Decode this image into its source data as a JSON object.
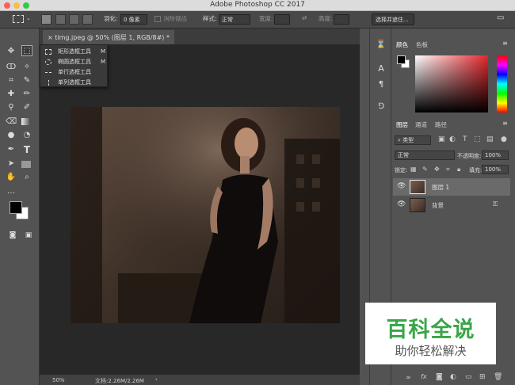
{
  "app": {
    "title": "Adobe Photoshop CC 2017"
  },
  "options_bar": {
    "feather_label": "羽化:",
    "feather_value": "0 像素",
    "antialias_label": "消除锯齿",
    "style_label": "样式:",
    "style_value": "正常",
    "width_label": "宽度:",
    "height_label": "高度:",
    "select_mask_button": "选择并遮住..."
  },
  "document": {
    "tab_label": "timg.jpeg @ 50% (图层 1, RGB/8#) *",
    "zoom": "50%",
    "doc_size": "文档:2.26M/2.26M"
  },
  "tool_flyout": {
    "items": [
      {
        "label": "矩形选框工具",
        "shortcut": "M"
      },
      {
        "label": "椭圆选框工具",
        "shortcut": "M"
      },
      {
        "label": "单行选框工具",
        "shortcut": ""
      },
      {
        "label": "单列选框工具",
        "shortcut": ""
      }
    ]
  },
  "color_panel": {
    "tabs": [
      "颜色",
      "色板"
    ],
    "foreground": "#000000",
    "background": "#ffffff"
  },
  "layers_panel": {
    "tabs": [
      "图层",
      "通道",
      "路径"
    ],
    "filter_kind": "类型",
    "blend_mode": "正常",
    "opacity_label": "不透明度:",
    "opacity_value": "100%",
    "lock_label": "锁定:",
    "fill_label": "填充:",
    "fill_value": "100%",
    "layers": [
      {
        "name": "图层 1",
        "selected": true
      },
      {
        "name": "背景",
        "selected": false
      }
    ]
  },
  "watermark": {
    "title": "百科全说",
    "subtitle": "助你轻松解决"
  }
}
